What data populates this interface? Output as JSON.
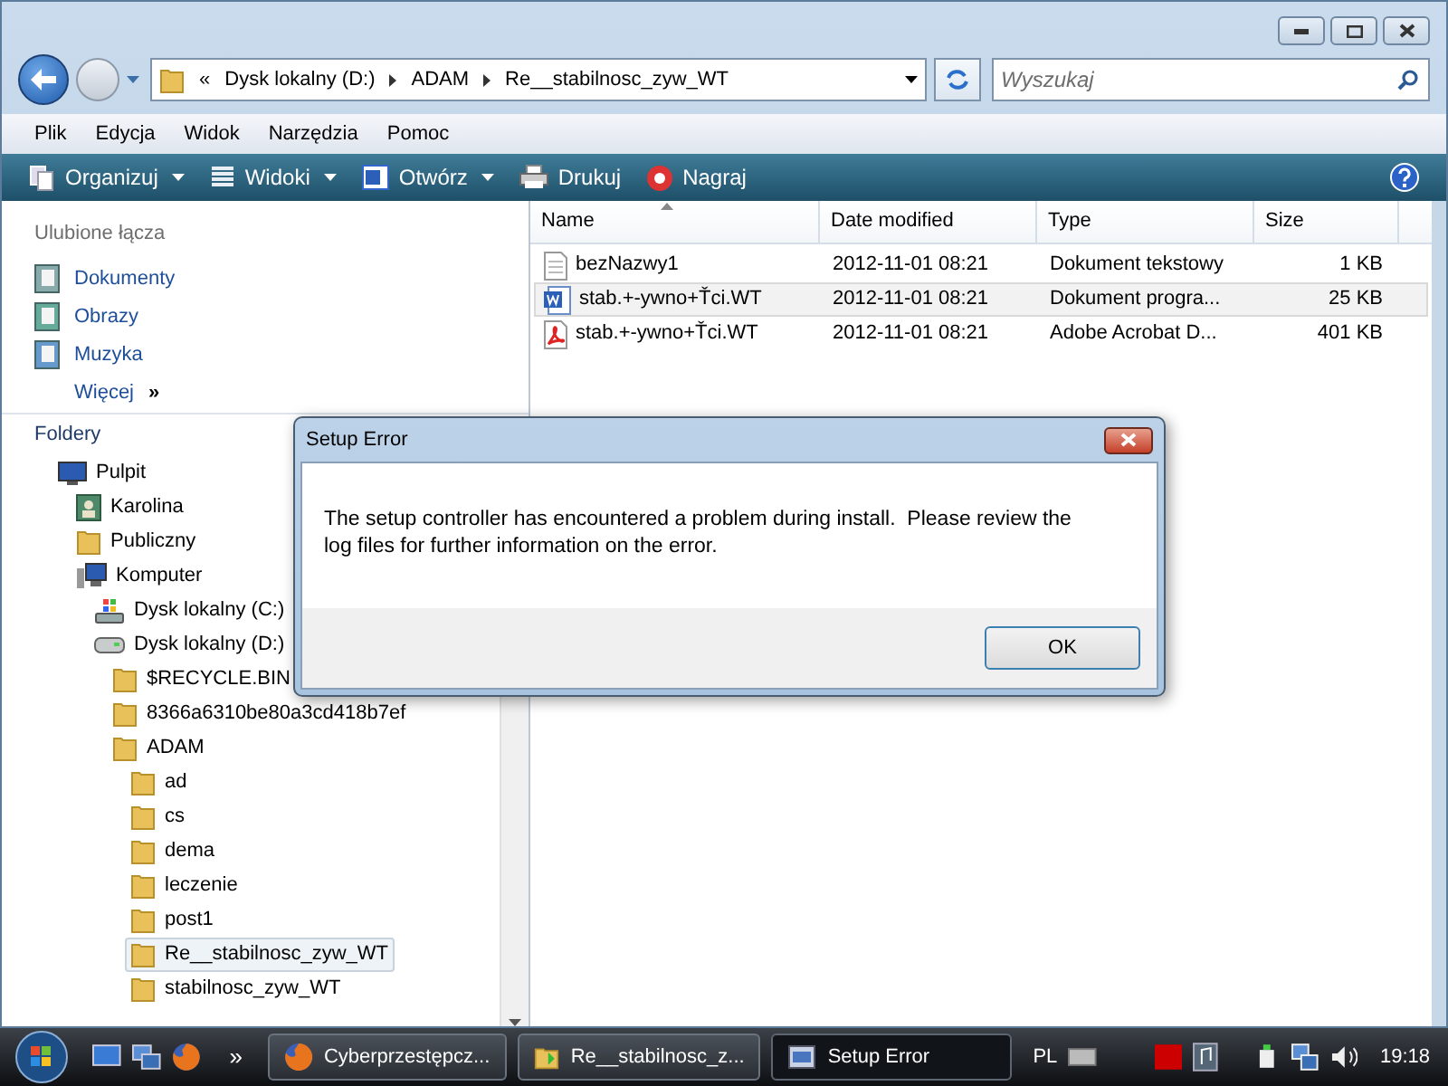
{
  "address_bar": {
    "breadcrumbs": [
      "«",
      "Dysk lokalny (D:)",
      "ADAM",
      "Re__stabilnosc_zyw_WT"
    ]
  },
  "search": {
    "placeholder": "Wyszukaj"
  },
  "menu_bar": [
    "Plik",
    "Edycja",
    "Widok",
    "Narzędzia",
    "Pomoc"
  ],
  "toolbar": [
    {
      "label": "Organizuj",
      "kind": "organize",
      "dropdown": true
    },
    {
      "label": "Widoki",
      "kind": "views",
      "dropdown": true
    },
    {
      "label": "Otwórz",
      "kind": "word",
      "dropdown": true
    },
    {
      "label": "Drukuj",
      "kind": "print",
      "dropdown": false
    },
    {
      "label": "Nagraj",
      "kind": "burn",
      "dropdown": false
    }
  ],
  "favorites": {
    "title": "Ulubione łącza",
    "items": [
      {
        "label": "Dokumenty",
        "kind": "documents"
      },
      {
        "label": "Obrazy",
        "kind": "pictures"
      },
      {
        "label": "Muzyka",
        "kind": "music"
      },
      {
        "label": "Więcej",
        "kind": "more"
      }
    ]
  },
  "more_glyph": "»",
  "folders": {
    "title": "Foldery",
    "tree": [
      {
        "label": "Pulpit",
        "kind": "desktop",
        "selected": false,
        "children": [
          {
            "label": "Karolina",
            "kind": "user",
            "selected": false
          },
          {
            "label": "Publiczny",
            "kind": "folder",
            "selected": false
          },
          {
            "label": "Komputer",
            "kind": "computer",
            "selected": false,
            "children": [
              {
                "label": "Dysk lokalny (C:)",
                "kind": "sysdrive",
                "selected": false
              },
              {
                "label": "Dysk lokalny (D:)",
                "kind": "drive",
                "selected": false,
                "children": [
                  {
                    "label": "$RECYCLE.BIN",
                    "kind": "folder",
                    "selected": false
                  },
                  {
                    "label": "8366a6310be80a3cd418b7ef",
                    "kind": "folder",
                    "selected": false
                  },
                  {
                    "label": "ADAM",
                    "kind": "folder",
                    "selected": false,
                    "children": [
                      {
                        "label": "ad",
                        "kind": "folder",
                        "selected": false
                      },
                      {
                        "label": "cs",
                        "kind": "folder",
                        "selected": false
                      },
                      {
                        "label": "dema",
                        "kind": "folder",
                        "selected": false
                      },
                      {
                        "label": "leczenie",
                        "kind": "folder",
                        "selected": false
                      },
                      {
                        "label": "post1",
                        "kind": "folder",
                        "selected": false
                      },
                      {
                        "label": "Re__stabilnosc_zyw_WT",
                        "kind": "folder",
                        "selected": true
                      },
                      {
                        "label": "stabilnosc_zyw_WT",
                        "kind": "folder",
                        "selected": false
                      }
                    ]
                  }
                ]
              }
            ]
          }
        ]
      }
    ]
  },
  "file_list": {
    "columns": [
      "Name",
      "Date modified",
      "Type",
      "Size"
    ],
    "rows": [
      {
        "name": "bezNazwy1",
        "kind": "text",
        "date": "2012-11-01 08:21",
        "type": "Dokument tekstowy",
        "size": "1 KB",
        "selected": false
      },
      {
        "name": "stab.+-ywno+Ťci.WT",
        "kind": "word",
        "date": "2012-11-01 08:21",
        "type": "Dokument progra...",
        "size": "25 KB",
        "selected": true
      },
      {
        "name": "stab.+-ywno+Ťci.WT",
        "kind": "pdf",
        "date": "2012-11-01 08:21",
        "type": "Adobe Acrobat D...",
        "size": "401 KB",
        "selected": false
      }
    ]
  },
  "dialog": {
    "title": "Setup Error",
    "message": "The setup controller has encountered a problem during install.  Please review the log files for further information on the error.",
    "button": "OK"
  },
  "taskbar": {
    "more_glyph": "»",
    "tasks": [
      {
        "label": "Cyberprzestępcz...",
        "kind": "firefox",
        "selected": false
      },
      {
        "label": "Re__stabilnosc_z...",
        "kind": "folder",
        "selected": false
      },
      {
        "label": "Setup Error",
        "kind": "setup",
        "selected": true
      }
    ],
    "language": "PL",
    "clock": "19:18"
  }
}
